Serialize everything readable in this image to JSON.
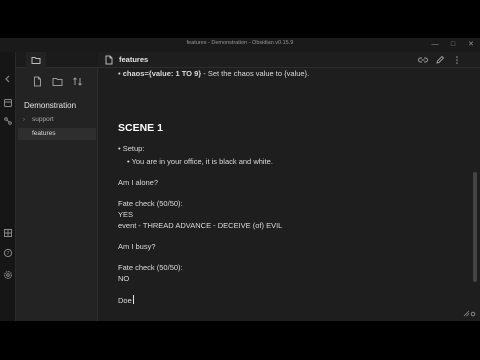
{
  "window": {
    "title": "features - Demonstration - Obsidian v0.15.9",
    "minimize": "—",
    "maximize": "□",
    "close": "✕"
  },
  "sidebar": {
    "vault_name": "Demonstration",
    "items": [
      {
        "label": "support",
        "caret": "›"
      },
      {
        "label": "features"
      }
    ]
  },
  "tab": {
    "title": "features"
  },
  "document": {
    "top_line_prefix": "• ",
    "top_line_bold": "chaos={value: 1 TO 9}",
    "top_line_rest": " - Set the chaos value to {value}.",
    "heading": "SCENE 1",
    "setup_label": "• Setup:",
    "setup_item": "• You are in your office, it is black and white.",
    "q1": "Am I alone?",
    "fate1": "Fate check (50/50):",
    "ans1": "YES",
    "event": "event - THREAD ADVANCE - DECEIVE (of) EVIL",
    "q2": "Am I busy?",
    "fate2": "Fate check (50/50):",
    "ans2": "NO",
    "typing": "Doe"
  }
}
